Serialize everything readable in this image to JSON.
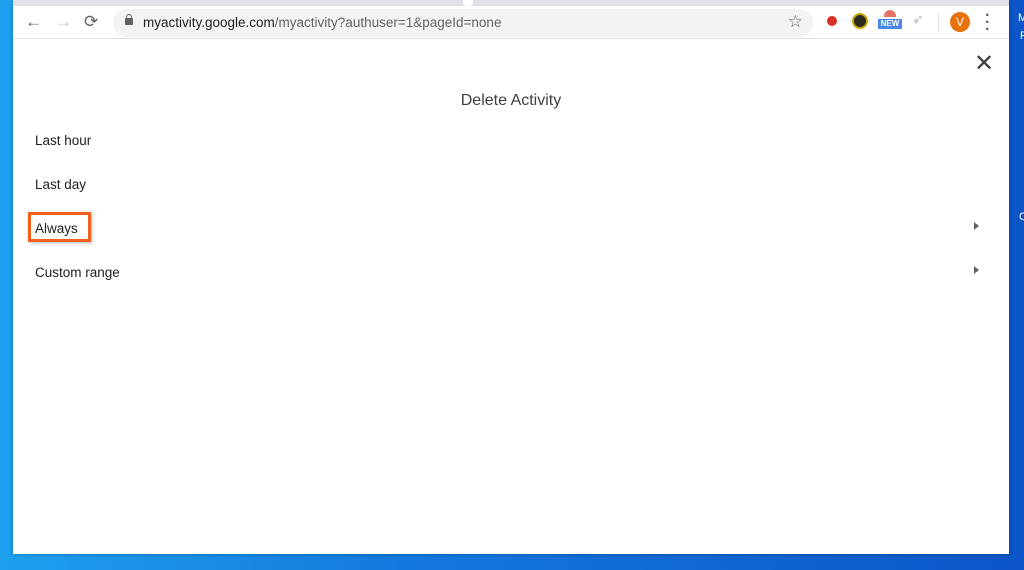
{
  "browser": {
    "url_host": "myactivity.google.com",
    "url_path": "/myactivity?authuser=1&pageId=none",
    "back": "←",
    "forward": "→",
    "reload": "⟳",
    "star": "☆",
    "ext_new_badge": "NEW",
    "avatar_letter": "V",
    "menu": "⋮"
  },
  "dialog": {
    "title": "Delete Activity",
    "close": "✕",
    "options": [
      {
        "label": "Last hour"
      },
      {
        "label": "Last day"
      },
      {
        "label": "Always"
      },
      {
        "label": "Custom range"
      }
    ]
  },
  "desktop": {
    "fragments": [
      "M",
      "F",
      "C"
    ]
  },
  "colors": {
    "highlight": "#f2601e",
    "avatar": "#e8710a"
  }
}
